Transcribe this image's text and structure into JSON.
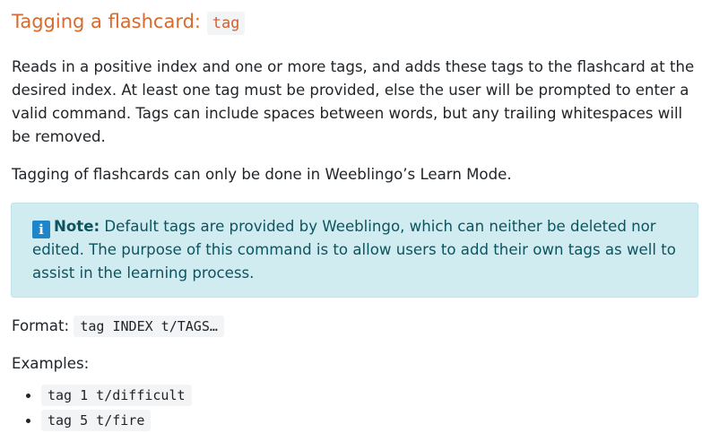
{
  "heading": {
    "text": "Tagging a flashcard:",
    "command": "tag"
  },
  "description": "Reads in a positive index and one or more tags, and adds these tags to the flashcard at the desired index. At least one tag must be provided, else the user will be prompted to enter a valid command. Tags can include spaces between words, but any trailing whitespaces will be removed.",
  "mode_note": "Tagging of flashcards can only be done in Weeblingo’s Learn Mode.",
  "note": {
    "icon": "info-icon",
    "label": "Note:",
    "text": "Default tags are provided by Weeblingo, which can neither be deleted nor edited. The purpose of this command is to allow users to add their own tags as well to assist in the learning process."
  },
  "format": {
    "label": "Format:",
    "command": "tag INDEX t/TAGS…"
  },
  "examples": {
    "label": "Examples:",
    "items": [
      "tag 1 t/difficult",
      "tag 5 t/fire"
    ]
  }
}
